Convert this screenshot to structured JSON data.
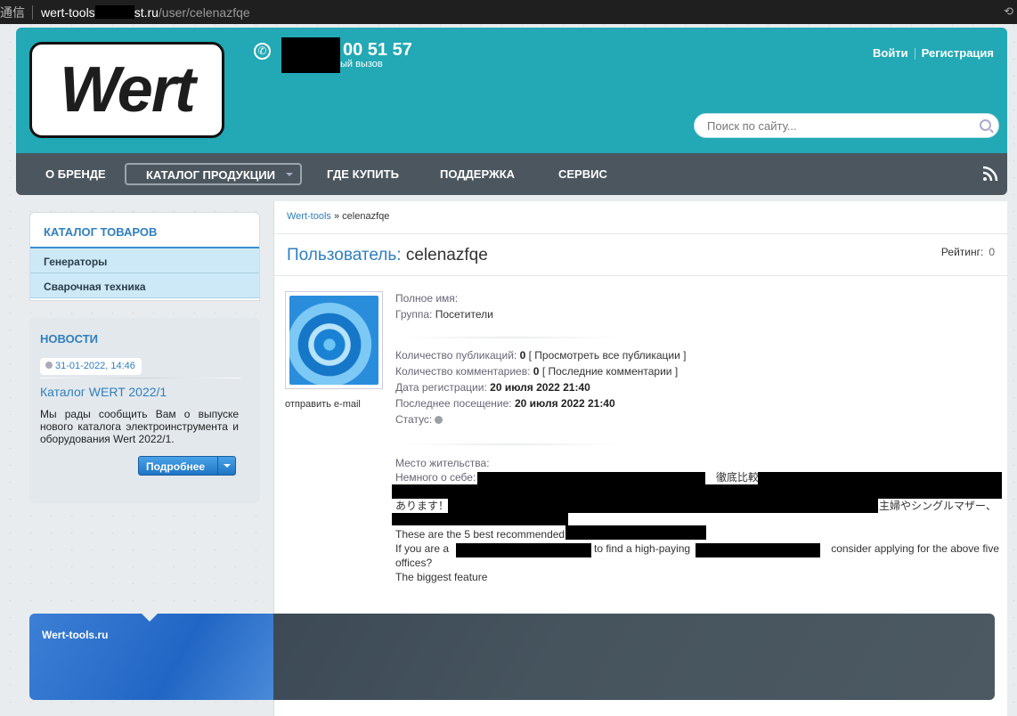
{
  "browser": {
    "security_label": "通信",
    "host_prefix": "wert-tools",
    "host_suffix": "st.ru",
    "path": "/user/celenazfqe"
  },
  "header": {
    "logo_text": "Wert",
    "phone_number": "00 51 57",
    "phone_caption": "ый вызов",
    "login": "Войти",
    "register": "Регистрация",
    "search_placeholder": "Поиск по сайту..."
  },
  "nav": {
    "items": [
      "О БРЕНДЕ",
      "КАТАЛОГ ПРОДУКЦИИ",
      "ГДЕ КУПИТЬ",
      "ПОДДЕРЖКА",
      "СЕРВИС"
    ]
  },
  "sidebar": {
    "catalog_title": "КАТАЛОГ ТОВАРОВ",
    "catalog_items": [
      "Генераторы",
      "Сварочная техника"
    ],
    "news_title": "НОВОСТИ",
    "news_date": "31-01-2022, 14:46",
    "news_headline": "Каталог WERT 2022/1",
    "news_text": "Мы рады сообщить Вам о выпуске нового каталога электроинструмента и оборудования Wert 2022/1.",
    "news_button": "Подробнее"
  },
  "breadcrumb": {
    "root": "Wert-tools",
    "sep": " » ",
    "current": "celenazfqe"
  },
  "profile": {
    "title_label": "Пользователь:",
    "username": "celenazfqe",
    "rating_label": "Рейтинг:",
    "rating_value": "0",
    "send_email": "отправить e-mail",
    "full_name_label": "Полное имя:",
    "group_label": "Группа:",
    "group_value": "Посетители",
    "pubs_label": "Количество публикаций:",
    "pubs_value": "0",
    "pubs_link": "[ Просмотреть все публикации ]",
    "comments_label": "Количество комментариев:",
    "comments_value": "0",
    "comments_link": "[ Последние комментарии ]",
    "reg_label": "Дата регистрации:",
    "reg_value": "20 июля 2022 21:40",
    "last_label": "Последнее посещение:",
    "last_value": "20 июля 2022 21:40",
    "status_label": "Статус:",
    "location_label": "Место жительства:",
    "about_label": "Немного о себе:",
    "about_fragment_1": "徹底比較！",
    "about_fragment_2": "あります！",
    "about_fragment_3": "主婦やシングルマザー、",
    "about_line_4": "These are the 5 best recommended",
    "about_line_5a": "If you are a",
    "about_line_5b": "to find a high-paying",
    "about_line_5c": "consider applying for the above five",
    "about_line_6": "offices?",
    "about_line_7": "The biggest feature"
  },
  "footer": {
    "site": "Wert-tools.ru"
  }
}
